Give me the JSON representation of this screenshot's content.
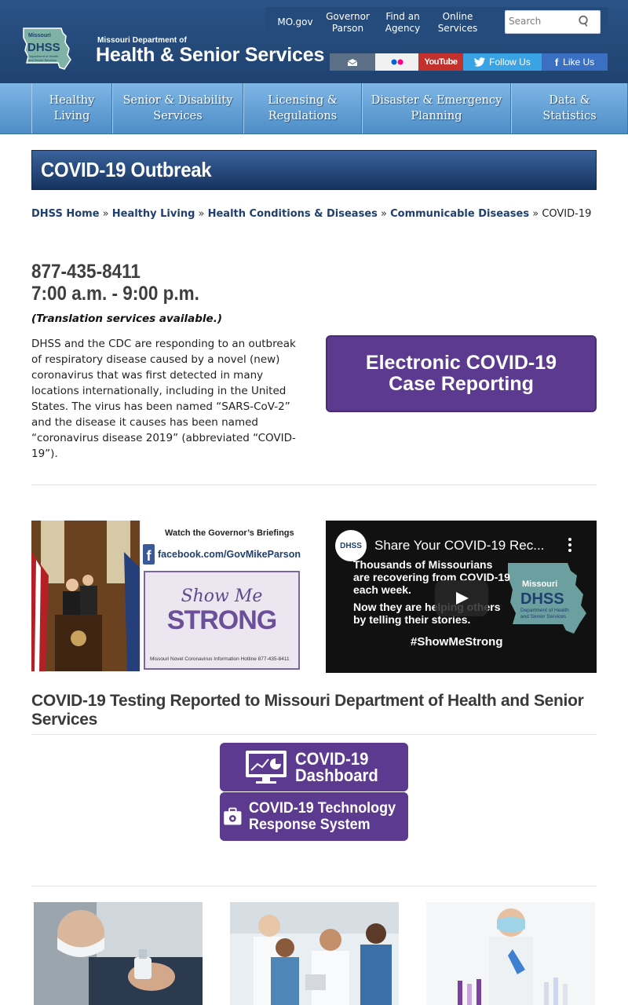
{
  "header": {
    "logo_small": "Missouri Department of",
    "logo_big": "Health & Senior Services",
    "logo_badge": "DHSS",
    "top_links": [
      "MO.gov",
      "Governor Parson",
      "Find an Agency",
      "Online Services"
    ],
    "search_placeholder": "Search",
    "social": {
      "email_icon": "envelope-icon",
      "flickr_icon": "flickr-icon",
      "youtube": "YouTube",
      "twitter": "Follow Us",
      "facebook": "Like Us"
    }
  },
  "nav": {
    "items": [
      "Healthy Living",
      "Senior & Disability Services",
      "Licensing & Regulations",
      "Disaster & Emergency Planning",
      "Data & Statistics"
    ]
  },
  "page": {
    "title": "COVID-19 Outbreak",
    "breadcrumb": [
      "DHSS Home",
      "Healthy Living",
      "Health Conditions & Diseases",
      "Communicable Diseases",
      "COVID-19"
    ],
    "phone": "877-435-8411",
    "hours": "7:00 a.m. - 9:00 p.m.",
    "translation": "(Translation services available.)",
    "intro": "DHSS and the CDC are responding to an outbreak of respiratory disease caused by a novel (new) coronavirus that was first detected in many locations internationally, including in the United States. The virus has been named “SARS-CoV-2” and the disease it causes has been named “coronavirus disease 2019” (abbreviated “COVID-19”).",
    "report_button_line1": "Electronic COVID-19",
    "report_button_line2": "Case Reporting"
  },
  "governor_banner": {
    "watch": "Watch the Governor’s Briefings",
    "facebook_url": "facebook.com/GovMikeParson",
    "show_me": "Show Me",
    "strong": "STRONG",
    "hotline": "Missouri Novel Coronavirus Information Hotline  877-435-8411"
  },
  "video": {
    "channel": "DHSS",
    "title": "Share Your COVID-19 Rec...",
    "line1": "Thousands of Missourians",
    "line2": "are recovering from COVID-19",
    "line3": "each week.",
    "line4": "Now they are helping others",
    "line5": "by telling their stories.",
    "hashtag": "#ShowMeStrong",
    "map_title": "Missouri",
    "map_badge": "DHSS",
    "map_sub1": "Department of Health",
    "map_sub2": "and Senior Services"
  },
  "testing": {
    "heading": "COVID-19 Testing Reported to Missouri Department of Health and Senior Services",
    "dashboard_line1": "COVID-19",
    "dashboard_line2": "Dashboard",
    "tech_line1": "COVID-19 Technology",
    "tech_line2": "Response System"
  },
  "colors": {
    "header_blue": "#1f4270",
    "nav_blue": "#5e9ad1",
    "link_blue": "#1f3f6e",
    "button_purple": "#5b3a8f"
  }
}
